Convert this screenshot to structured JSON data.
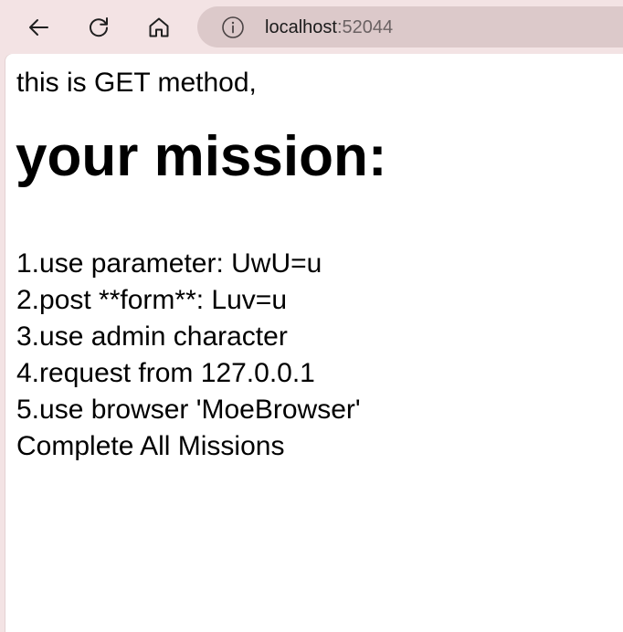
{
  "browser": {
    "url_host": "localhost",
    "url_port": ":52044",
    "icons": {
      "back": "back-arrow-icon",
      "refresh": "refresh-icon",
      "home": "home-icon",
      "site_info": "info-icon"
    }
  },
  "page": {
    "intro": "this is GET method,",
    "heading": "your mission:",
    "missions": [
      "1.use parameter: UwU=u",
      "2.post **form**: Luv=u",
      "3.use admin character",
      "4.request from 127.0.0.1",
      "5.use browser 'MoeBrowser'",
      "Complete All Missions"
    ]
  },
  "colors": {
    "chrome_background": "#f3e3e4",
    "address_bar": "#dcc9ca",
    "page_background": "#ffffff",
    "text": "#000000"
  }
}
